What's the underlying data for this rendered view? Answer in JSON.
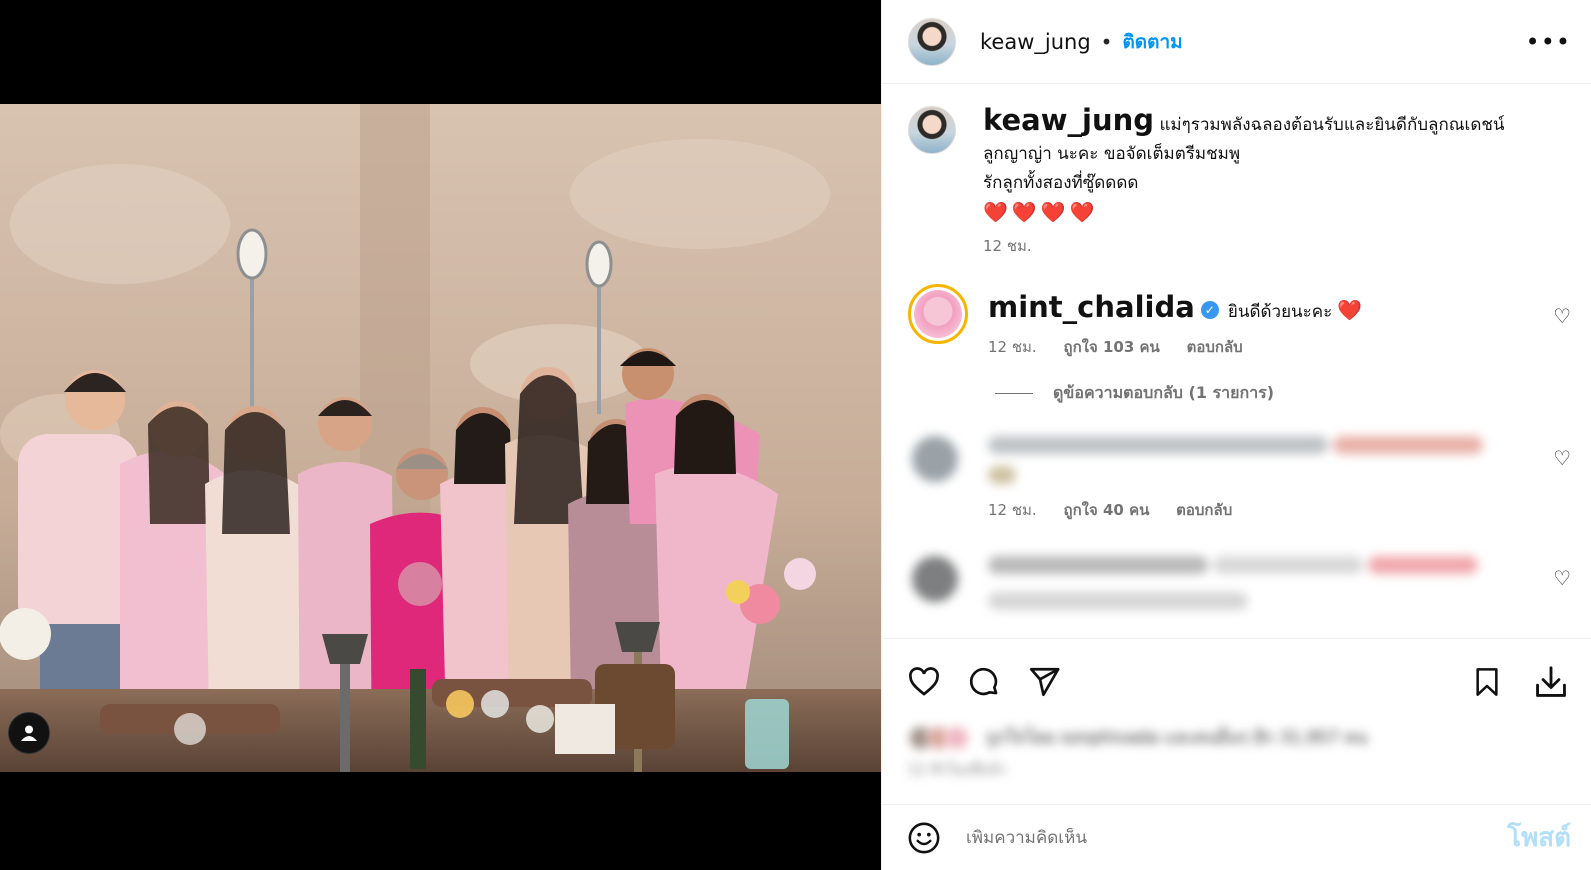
{
  "post": {
    "author": "keaw_jung",
    "follow_label": "ติดตาม",
    "more_label": "•••",
    "caption_line1": "แม่ๆรวมพลังฉลองต้อนรับและยินดีกับลูกณเดชน์",
    "caption_line2": "ลูกญาญ่า นะคะ ขอจัดเต็มตรีมชมพู",
    "caption_line3": "รักลูกทั้งสองที่ซู๊ดดดด",
    "caption_emoji": "❤️❤️❤️❤️",
    "caption_time": "12 ชม."
  },
  "comments": [
    {
      "user": "mint_chalida",
      "text": "ยินดีด้วยนะคะ",
      "emoji": "❤️",
      "time": "12 ชม.",
      "likes": "ถูกใจ 103 คน",
      "reply": "ตอบกลับ",
      "view_replies": "ดูข้อความตอบกลับ (1 รายการ)"
    },
    {
      "time": "12 ชม.",
      "likes": "ถูกใจ 40 คน",
      "reply": "ตอบกลับ"
    }
  ],
  "likes_summary": {
    "text": "ถูกใจโดย sonphivada และคนอื่นๆ อีก 31,957 คน",
    "date": "12 ชั่วโมงที่แล้ว"
  },
  "add_comment": {
    "placeholder": "เพิ่มความคิดเห็น",
    "post_label": "โพสต์"
  },
  "icons": {
    "like": "heart-icon",
    "comment": "comment-icon",
    "share": "share-icon",
    "save": "bookmark-icon",
    "download": "download-icon",
    "emoji": "emoji-icon",
    "tag": "user-tag-icon"
  },
  "colors": {
    "accent": "#0095f6",
    "verified": "#3897f0",
    "heart": "#e01c30"
  }
}
